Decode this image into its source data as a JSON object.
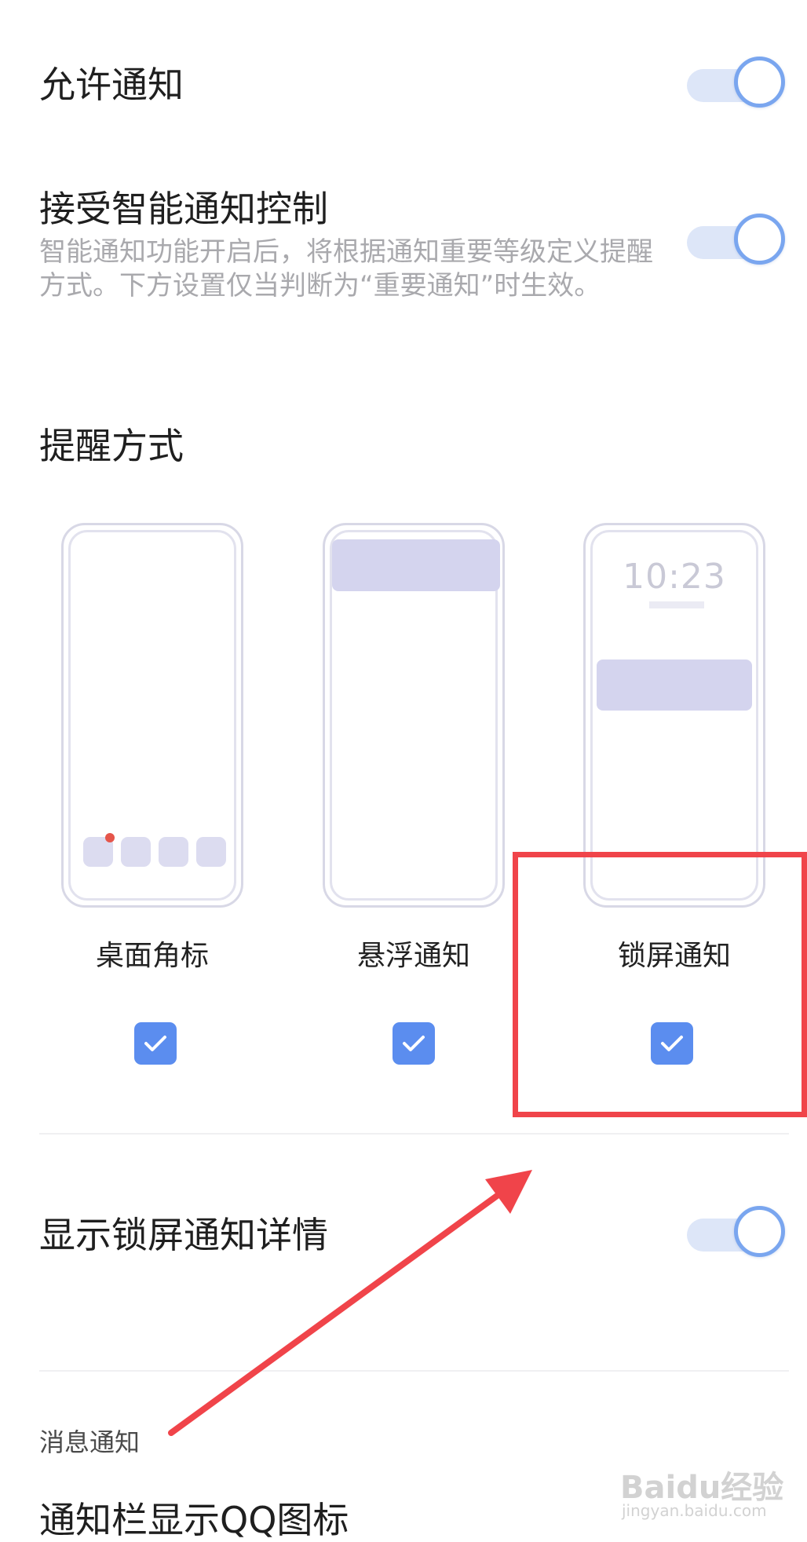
{
  "settings": {
    "allow_notifications": {
      "label": "允许通知",
      "enabled": true
    },
    "smart_control": {
      "label": "接受智能通知控制",
      "description": "智能通知功能开启后，将根据通知重要等级定义提醒方式。下方设置仅当判断为“重要通知”时生效。",
      "enabled": true
    }
  },
  "reminder": {
    "title": "提醒方式",
    "options": [
      {
        "label": "桌面角标",
        "checked": true
      },
      {
        "label": "悬浮通知",
        "checked": true
      },
      {
        "label": "锁屏通知",
        "checked": true
      }
    ],
    "lock_preview_time": "10:23"
  },
  "lock_details": {
    "label": "显示锁屏通知详情",
    "enabled": true
  },
  "message_section": {
    "title": "消息通知"
  },
  "partial_row": {
    "label": "通知栏显示QQ图标"
  },
  "watermark": {
    "brand": "Baidu经验",
    "url": "jingyan.baidu.com"
  },
  "colors": {
    "accent": "#5b8def",
    "toggle_track": "#dde6f8",
    "toggle_knob_border": "#7aa6ef",
    "annotation_red": "#f0444a",
    "badge_red": "#e5554a"
  }
}
